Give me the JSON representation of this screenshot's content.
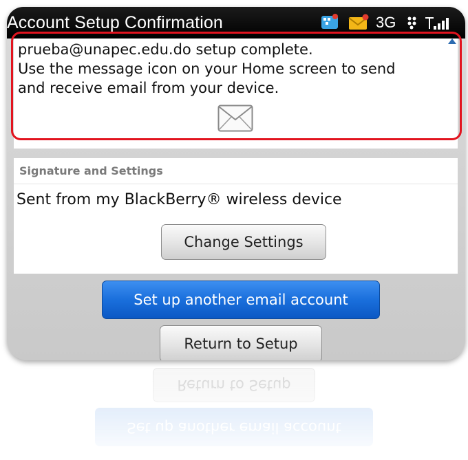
{
  "window": {
    "title": "Account Setup Confirmation"
  },
  "status_bar": {
    "network_type": "3G",
    "icons": [
      "bbm-icon",
      "new-mail-notification-icon",
      "bluetooth-icon",
      "signal-strength-icon"
    ]
  },
  "message": {
    "line1": "prueba@unapec.edu.do setup complete.",
    "line2": "Use the message icon on your Home screen to send",
    "line3": "and receive email from your device.",
    "icon": "envelope-icon",
    "highlight_color": "#e2141f"
  },
  "signature": {
    "header": "Signature and Settings",
    "text": "Sent from my BlackBerry® wireless device",
    "change_settings_label": "Change Settings"
  },
  "actions": {
    "setup_another_label": "Set up another email account",
    "return_label": "Return to Setup"
  },
  "colors": {
    "title_bar": "#000000",
    "primary_button": "#1a6fdc",
    "background": "#d4d4d4"
  }
}
